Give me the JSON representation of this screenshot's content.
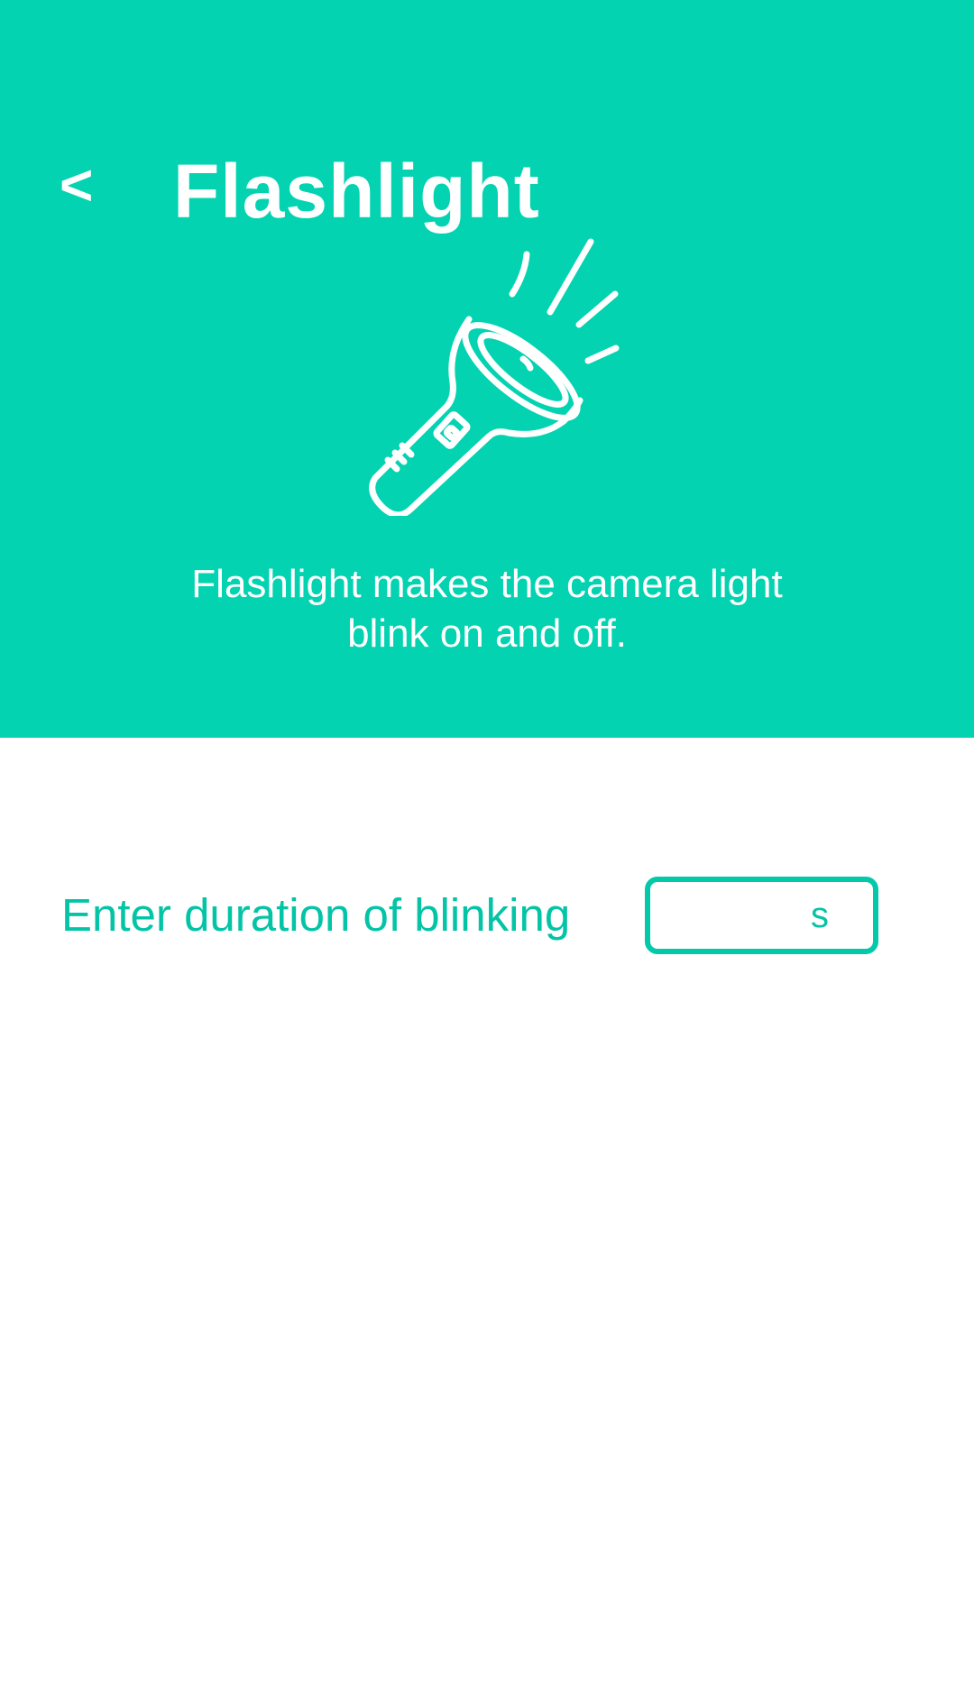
{
  "header": {
    "back_label": "<",
    "title": "Flashlight",
    "description_line1": "Flashlight makes the camera light",
    "description_line2": "blink on and off."
  },
  "form": {
    "duration_label": "Enter duration of blinking",
    "duration_value": "",
    "unit": "s"
  },
  "icons": {
    "illustration": "flashlight-icon",
    "back": "chevron-left-icon"
  },
  "colors": {
    "accent": "#03d3b1",
    "text_accent": "#03c4a6",
    "background": "#ffffff"
  }
}
